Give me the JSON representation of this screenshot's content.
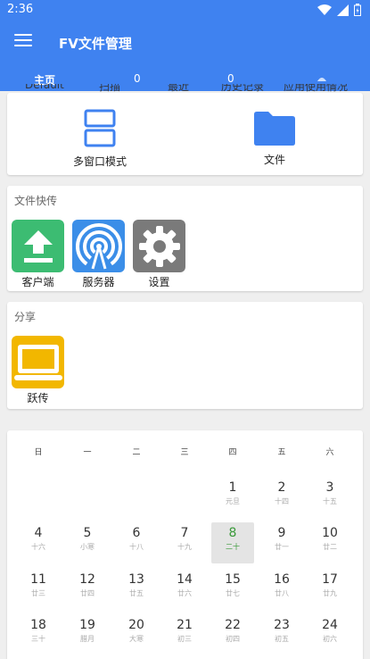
{
  "status": {
    "time": "2:36"
  },
  "app": {
    "title": "FV文件管理"
  },
  "tabs": [
    {
      "label": "主页"
    },
    {
      "label": "0"
    },
    {
      "label": "0"
    },
    {
      "label": ""
    }
  ],
  "tabs_cut": [
    "Default",
    "扫描",
    "最近",
    "历史记录",
    "应用使用情况"
  ],
  "top_card": {
    "items": [
      {
        "label": "多窗口模式",
        "icon": "multi-window-icon"
      },
      {
        "label": "文件",
        "icon": "folder-icon"
      }
    ]
  },
  "quick_transfer": {
    "title": "文件快传",
    "apps": [
      {
        "label": "客户端",
        "icon": "upload-icon",
        "color": "#3cbc72"
      },
      {
        "label": "服务器",
        "icon": "broadcast-icon",
        "color": "#3b8ee8"
      },
      {
        "label": "设置",
        "icon": "gear-icon",
        "color": "#7a7a7a"
      }
    ]
  },
  "share": {
    "title": "分享",
    "apps": [
      {
        "label": "跃传",
        "icon": "laptop-icon",
        "color": "#f2b700"
      }
    ]
  },
  "calendar": {
    "weekdays": [
      "日",
      "一",
      "二",
      "三",
      "四",
      "五",
      "六"
    ],
    "rows": [
      [
        null,
        null,
        null,
        null,
        {
          "d": "1",
          "l": "元旦"
        },
        {
          "d": "2",
          "l": "十四"
        },
        {
          "d": "3",
          "l": "十五"
        }
      ],
      [
        {
          "d": "4",
          "l": "十六"
        },
        {
          "d": "5",
          "l": "小寒"
        },
        {
          "d": "6",
          "l": "十八"
        },
        {
          "d": "7",
          "l": "十九"
        },
        {
          "d": "8",
          "l": "二十",
          "today": true
        },
        {
          "d": "9",
          "l": "廿一"
        },
        {
          "d": "10",
          "l": "廿二"
        }
      ],
      [
        {
          "d": "11",
          "l": "廿三"
        },
        {
          "d": "12",
          "l": "廿四"
        },
        {
          "d": "13",
          "l": "廿五"
        },
        {
          "d": "14",
          "l": "廿六"
        },
        {
          "d": "15",
          "l": "廿七"
        },
        {
          "d": "16",
          "l": "廿八"
        },
        {
          "d": "17",
          "l": "廿九"
        }
      ],
      [
        {
          "d": "18",
          "l": "三十"
        },
        {
          "d": "19",
          "l": "腊月"
        },
        {
          "d": "20",
          "l": "大寒"
        },
        {
          "d": "21",
          "l": "初三"
        },
        {
          "d": "22",
          "l": "初四"
        },
        {
          "d": "23",
          "l": "初五"
        },
        {
          "d": "24",
          "l": "初六"
        }
      ]
    ]
  },
  "colors": {
    "primary": "#3f82f0",
    "today": "#3a9a3a"
  }
}
